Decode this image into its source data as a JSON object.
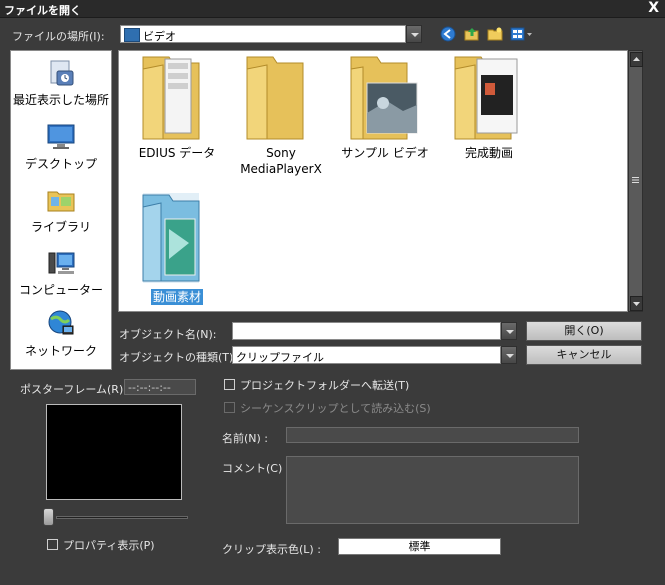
{
  "window": {
    "title": "ファイルを開く",
    "close_glyph": "X"
  },
  "location": {
    "label": "ファイルの場所(I):",
    "value": "ビデオ"
  },
  "sidebar": {
    "items": [
      {
        "label": "最近表示した場所"
      },
      {
        "label": "デスクトップ"
      },
      {
        "label": "ライブラリ"
      },
      {
        "label": "コンピューター"
      },
      {
        "label": "ネットワーク"
      }
    ]
  },
  "files": [
    {
      "label": "EDIUS データ"
    },
    {
      "label": "Sony\nMediaPlayerX"
    },
    {
      "label": "サンプル ビデオ"
    },
    {
      "label": "完成動画"
    },
    {
      "label": "動画素材"
    }
  ],
  "object_name": {
    "label": "オブジェクト名(N):",
    "value": ""
  },
  "object_type": {
    "label": "オブジェクトの種類(T):",
    "value": "クリップファイル"
  },
  "buttons": {
    "open": "開く(O)",
    "cancel": "キャンセル"
  },
  "poster": {
    "label": "ポスターフレーム(R) :",
    "timecode": "--:--:--:--"
  },
  "options": {
    "transfer": "プロジェクトフォルダーへ転送(T)",
    "sequence": "シーケンスクリップとして読み込む(S)",
    "properties": "プロパティ表示(P)"
  },
  "fields": {
    "name_label": "名前(N) :",
    "comment_label": "コメント(C) :",
    "clip_color_label": "クリップ表示色(L) :",
    "clip_color_value": "標準"
  }
}
